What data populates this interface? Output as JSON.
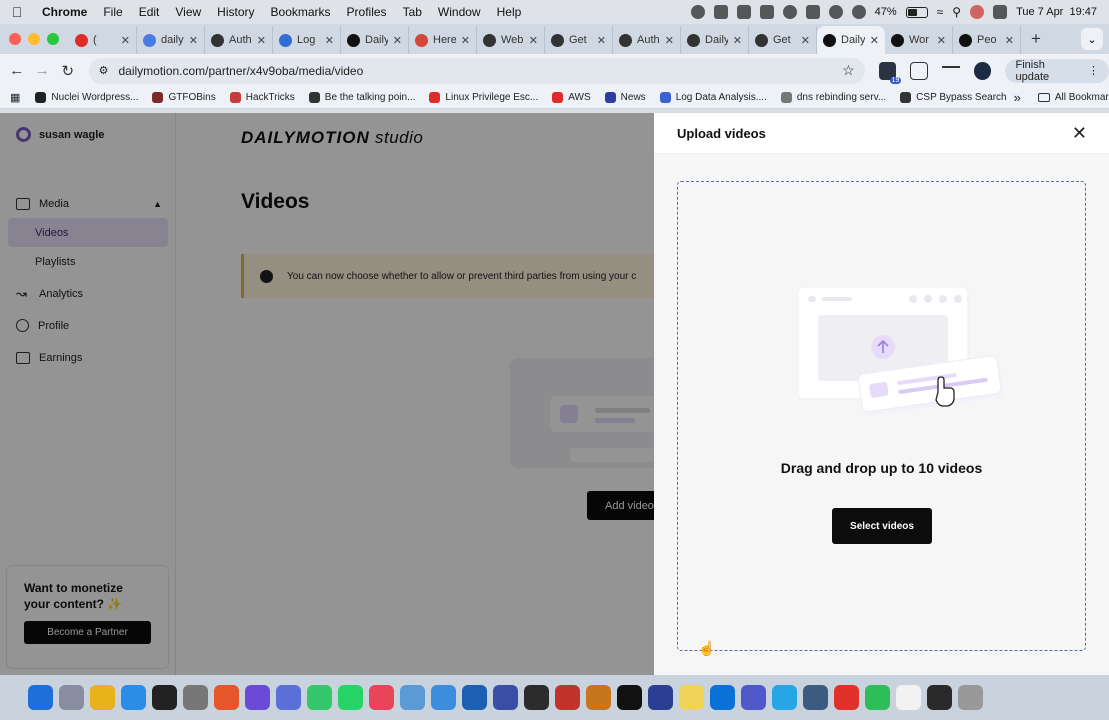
{
  "menubar": {
    "app": "Chrome",
    "items": [
      "File",
      "Edit",
      "View",
      "History",
      "Bookmarks",
      "Profiles",
      "Tab",
      "Window",
      "Help"
    ],
    "battery": "47%",
    "datetime": "Tue 7 Apr  19:47"
  },
  "tabs": [
    {
      "label": "(",
      "icon": "youtube-icon",
      "color": "#e02b2b"
    },
    {
      "label": "daily",
      "icon": "google-icon",
      "color": "#4a7be0"
    },
    {
      "label": "Auth",
      "icon": "openai-icon",
      "color": "#333333"
    },
    {
      "label": "Log",
      "icon": "doc-icon",
      "color": "#2f6fd6"
    },
    {
      "label": "Daily",
      "icon": "dailymotion-icon",
      "color": "#111111"
    },
    {
      "label": "Here",
      "icon": "gmail-icon",
      "color": "#d44638"
    },
    {
      "label": "Web",
      "icon": "openai-icon",
      "color": "#333333"
    },
    {
      "label": "Get",
      "icon": "openai-icon",
      "color": "#333333"
    },
    {
      "label": "Auth",
      "icon": "openai-icon",
      "color": "#333333"
    },
    {
      "label": "Daily",
      "icon": "github-icon",
      "color": "#333333"
    },
    {
      "label": "Get",
      "icon": "openai-icon",
      "color": "#333333"
    },
    {
      "label": "Daily",
      "icon": "dailymotion-icon",
      "color": "#111111",
      "active": true
    },
    {
      "label": "Wor",
      "icon": "dailymotion-icon",
      "color": "#111111"
    },
    {
      "label": "Peo",
      "icon": "dailymotion-icon",
      "color": "#111111"
    }
  ],
  "toolbar": {
    "url": "dailymotion.com/partner/x4v9oba/media/video",
    "extension_badge": "19",
    "finish_update": "Finish update"
  },
  "bookmarks": [
    {
      "label": "Nuclei Wordpress...",
      "color": "#222222"
    },
    {
      "label": "GTFOBins",
      "color": "#7a2a2a"
    },
    {
      "label": "HackTricks",
      "color": "#c43c3c"
    },
    {
      "label": "Be the talking poin...",
      "color": "#333333"
    },
    {
      "label": "Linux Privilege Esc...",
      "color": "#e02b2b"
    },
    {
      "label": "AWS",
      "color": "#e02b2b"
    },
    {
      "label": "News",
      "color": "#2e3ea0"
    },
    {
      "label": "Log Data Analysis....",
      "color": "#3a63d1"
    },
    {
      "label": "dns rebinding serv...",
      "color": "#777777"
    },
    {
      "label": "CSP Bypass Search",
      "color": "#333333"
    }
  ],
  "bookmarks_more": "»",
  "bookmarks_all": "All Bookmarks",
  "sidebar": {
    "user": "susan wagle",
    "items": [
      {
        "label": "Media",
        "icon": "media-icon",
        "expanded": true
      },
      {
        "label": "Videos",
        "sub": true,
        "selected": true
      },
      {
        "label": "Playlists",
        "sub": true
      },
      {
        "label": "Analytics",
        "icon": "analytics-icon"
      },
      {
        "label": "Profile",
        "icon": "profile-icon"
      },
      {
        "label": "Earnings",
        "icon": "earnings-icon"
      }
    ],
    "monetize_title": "Want to monetize your content? ✨",
    "partner_button": "Become a Partner"
  },
  "main": {
    "brand": "DAILYMOTION",
    "brand_suffix": "studio",
    "title": "Videos",
    "notice": "You can now choose whether to allow or prevent third parties from using your c",
    "add_video": "Add video"
  },
  "drawer": {
    "title": "Upload videos",
    "dropzone_text": "Drag and drop up to 10 videos",
    "select_button": "Select videos"
  },
  "dock_colors": [
    "#1e6fd9",
    "#888ea0",
    "#e8b21a",
    "#2b8de8",
    "#222222",
    "#777777",
    "#e5562a",
    "#6b4bd6",
    "#5b6fd9",
    "#36c76a",
    "#25d366",
    "#e8455a",
    "#5b9bd5",
    "#3c8de0",
    "#1d5fb3",
    "#3a4ea8",
    "#2c2c2c",
    "#c0342b",
    "#c8761e",
    "#111111",
    "#2c3e94",
    "#f0d45a",
    "#0a72d6",
    "#5059c9",
    "#27a6e5",
    "#3d5a80",
    "#e0322b",
    "#2ebd59",
    "#f2f2f2",
    "#2a2a2a",
    "#999999"
  ]
}
